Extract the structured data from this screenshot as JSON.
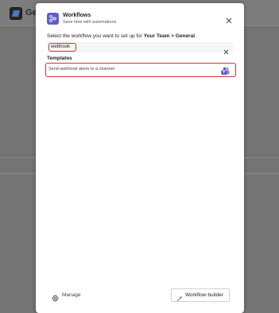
{
  "background": {
    "channel_title": "Gene"
  },
  "dialog": {
    "title": "Workflows",
    "subtitle": "Save time with automations",
    "instruction_prefix": "Select the workflow you want to set up for ",
    "instruction_target": "Your Team > General",
    "instruction_suffix": "."
  },
  "search": {
    "value": "webhook"
  },
  "templates": {
    "section_label": "Templates",
    "items": [
      {
        "label": "Send webhook alerts to a channel",
        "icon": "teams-icon"
      }
    ]
  },
  "footer": {
    "manage_label": "Manage",
    "builder_label": "Workflow builder"
  },
  "colors": {
    "accent": "#5b5fc7",
    "highlight": "#d13438"
  }
}
